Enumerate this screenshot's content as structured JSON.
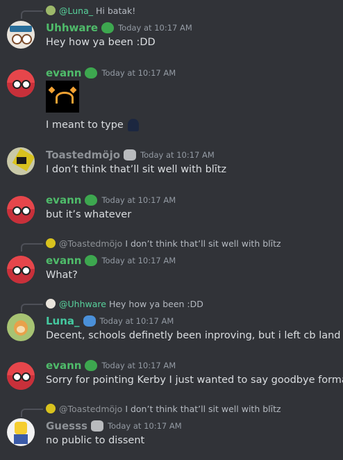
{
  "messages": [
    {
      "reply": {
        "name": "@Luna_",
        "text": "Hi batak!"
      },
      "author": "Uhhware",
      "time": "Today at 10:17 AM",
      "content": "Hey how ya been :DD"
    },
    {
      "author": "evann",
      "time": "Today at 10:17 AM",
      "content": "I meant to type"
    },
    {
      "author": "Toastedmöjo",
      "time": "Today at 10:17 AM",
      "content": "I don’t think that’ll sit well with blītz"
    },
    {
      "author": "evann",
      "time": "Today at 10:17 AM",
      "content": "but it’s whatever"
    },
    {
      "reply": {
        "name": "@Toastedmöjo",
        "text": "I don’t think that’ll sit well with blītz"
      },
      "author": "evann",
      "time": "Today at 10:17 AM",
      "content": "What?"
    },
    {
      "reply": {
        "name": "@Uhhware",
        "text": "Hey how ya been :DD"
      },
      "author": "Luna_",
      "time": "Today at 10:17 AM",
      "content": "Decent, schools definetly been inproving, but i left cb land"
    },
    {
      "author": "evann",
      "time": "Today at 10:17 AM",
      "content": "Sorry for pointing Kerby I just wanted to say goodbye formally"
    },
    {
      "reply": {
        "name": "@Toastedmöjo",
        "text": "I don’t think that’ll sit well with blītz"
      },
      "author": "Guesss",
      "time": "Today at 10:17 AM",
      "content": "no public to dissent"
    }
  ],
  "colors": {
    "background": "#313338",
    "green_name": "#4fbb6a",
    "grey_name": "#8e9297",
    "mention": "#58d29c"
  }
}
